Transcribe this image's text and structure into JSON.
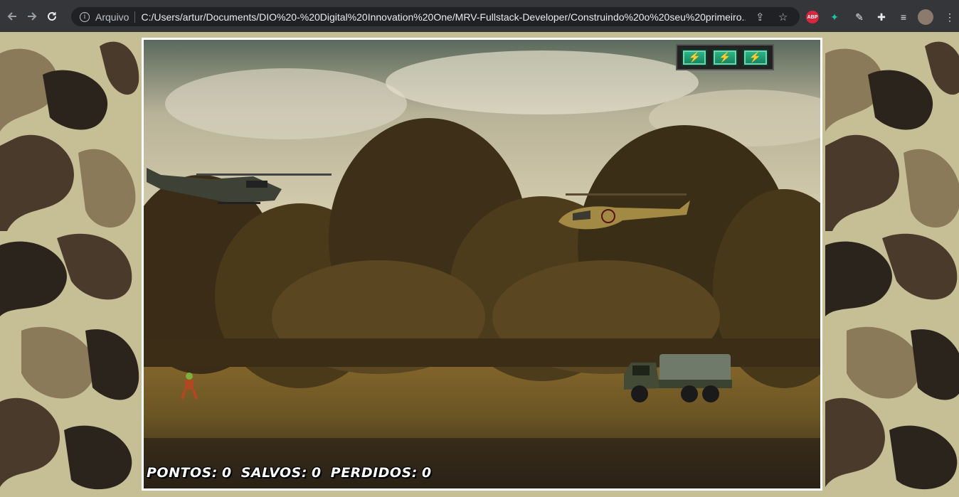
{
  "browser": {
    "back_icon": "arrow-left-icon",
    "forward_icon": "arrow-right-icon",
    "reload_icon": "reload-icon",
    "security_label": "Arquivo",
    "url": "C:/Users/artur/Documents/DIO%20-%20Digital%20Innovation%20One/MRV-Fullstack-Developer/Construindo%20o%20seu%20primeiro...",
    "extensions": [
      "share-icon",
      "star-icon",
      "adblock-icon",
      "leaf-extension-icon",
      "pen-icon",
      "puzzle-icon",
      "media-queue-icon",
      "avatar",
      "menu-kebab-icon"
    ],
    "abp_label": "ABP"
  },
  "game": {
    "energy": {
      "cells": 3,
      "max": 3
    },
    "score": {
      "points_label": "PONTOS:",
      "points_value": "0",
      "saved_label": "SALVOS:",
      "saved_value": "0",
      "lost_label": "PERDIDOS:",
      "lost_value": "0"
    },
    "sprites": {
      "player": "player-helicopter",
      "enemy_helicopter": "enemy-helicopter",
      "truck": "enemy-truck",
      "friend": "friend-soldier"
    }
  },
  "colors": {
    "camo_light": "#c6be95",
    "camo_mid": "#8a7a5a",
    "camo_dark": "#4a3a2c",
    "camo_black": "#2b241d",
    "frame_border": "#ffffff",
    "energy_green": "#2fb88a"
  }
}
